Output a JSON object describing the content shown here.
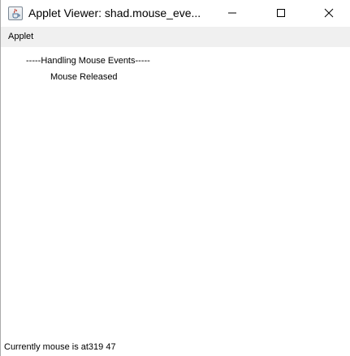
{
  "window": {
    "title": "Applet Viewer: shad.mouse_eve...",
    "icon": "java-cup-icon",
    "controls": [
      "minimize-icon",
      "maximize-icon",
      "close-icon"
    ]
  },
  "menubar": {
    "items": [
      {
        "label": "Applet"
      }
    ]
  },
  "applet": {
    "heading": "-----Handling Mouse Events-----",
    "event_text": "Mouse Released"
  },
  "status": {
    "text": "Currently mouse is at319 47"
  }
}
